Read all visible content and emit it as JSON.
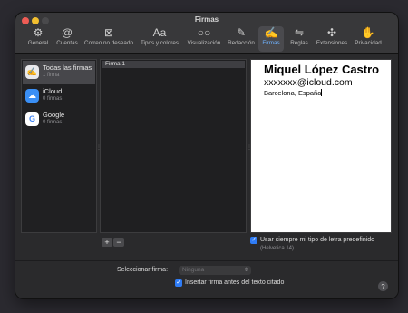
{
  "window": {
    "title": "Firmas"
  },
  "toolbar": {
    "items": [
      {
        "label": "General",
        "icon": "gear-icon",
        "glyph": "⚙"
      },
      {
        "label": "Cuentas",
        "icon": "at-icon",
        "glyph": "@"
      },
      {
        "label": "Correo no deseado",
        "icon": "junk-tray-icon",
        "glyph": "⊠"
      },
      {
        "label": "Tipos y colores",
        "icon": "font-icon",
        "glyph": "Aa"
      },
      {
        "label": "Visualización",
        "icon": "glasses-icon",
        "glyph": "○○"
      },
      {
        "label": "Redacción",
        "icon": "compose-icon",
        "glyph": "✎"
      },
      {
        "label": "Firmas",
        "icon": "signature-icon",
        "glyph": "✍"
      },
      {
        "label": "Reglas",
        "icon": "rules-icon",
        "glyph": "⇋"
      },
      {
        "label": "Extensiones",
        "icon": "puzzle-icon",
        "glyph": "✣"
      },
      {
        "label": "Privacidad",
        "icon": "hand-icon",
        "glyph": "✋"
      }
    ],
    "active": "Firmas"
  },
  "accounts": [
    {
      "name": "Todas las firmas",
      "count": "1 firma",
      "icon": "signature-icon",
      "selected": true
    },
    {
      "name": "iCloud",
      "count": "0 firmas",
      "icon": "cloud-icon",
      "selected": false
    },
    {
      "name": "Google",
      "count": "0 firmas",
      "icon": "google-icon",
      "selected": false
    }
  ],
  "signatures": [
    "Firma 1"
  ],
  "editor": {
    "name": "Miquel López Castro",
    "email": "xxxxxxx@icloud.com",
    "city": "Barcelona, España"
  },
  "buttons": {
    "add": "+",
    "remove": "−"
  },
  "font_option": {
    "label": "Usar siempre mi tipo de letra predefinido",
    "hint": "(Helvetica 14)",
    "checked": true
  },
  "footer": {
    "select_label": "Seleccionar firma:",
    "select_value": "Ninguna",
    "insert_label": "Insertar firma antes del texto citado",
    "insert_checked": true,
    "help": "?"
  },
  "colors": {
    "accent": "#2f7cf6",
    "active_tab": "#6fb2ff",
    "icloud": "#3a8ff5",
    "google": "#ffffff"
  }
}
